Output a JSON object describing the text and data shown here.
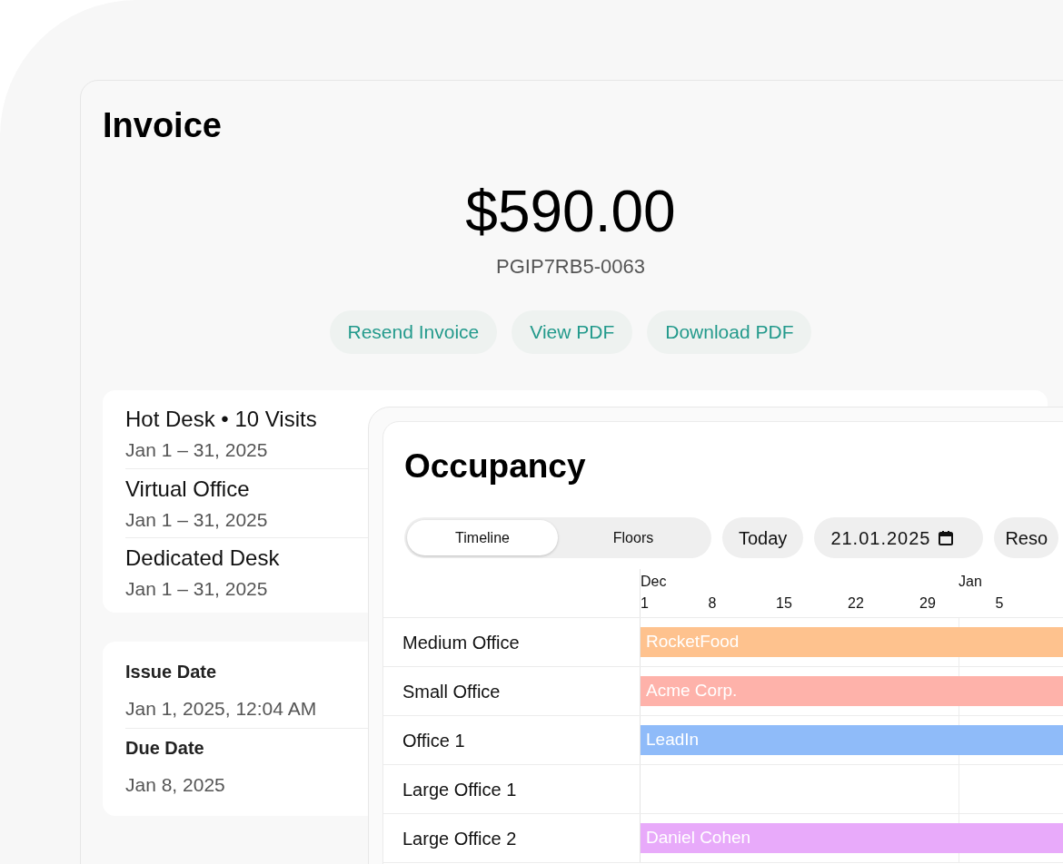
{
  "invoice": {
    "title": "Invoice",
    "amount": "$590.00",
    "number": "PGIP7RB5-0063",
    "actions": [
      "Resend Invoice",
      "View PDF",
      "Download PDF"
    ],
    "line_items": [
      {
        "name": "Hot Desk • 10 Visits",
        "dates": "Jan 1 – 31, 2025"
      },
      {
        "name": "Virtual Office",
        "dates": "Jan 1 – 31, 2025"
      },
      {
        "name": "Dedicated Desk",
        "dates": "Jan 1 – 31, 2025"
      }
    ],
    "dates": [
      {
        "label": "Issue Date",
        "value": "Jan 1, 2025, 12:04 AM"
      },
      {
        "label": "Due Date",
        "value": "Jan 8, 2025"
      }
    ]
  },
  "occupancy": {
    "title": "Occupancy",
    "view_tabs": [
      {
        "label": "Timeline",
        "selected": true
      },
      {
        "label": "Floors",
        "selected": false
      }
    ],
    "today_button": "Today",
    "date_field": {
      "value": "21.01.2025"
    },
    "resources_button": "Reso",
    "months": [
      "Dec",
      "Jan"
    ],
    "ticks": [
      "1",
      "8",
      "15",
      "22",
      "29",
      "5"
    ],
    "rows": [
      {
        "name": "Medium Office",
        "booking": {
          "label": "RocketFood",
          "color": "#fec28e"
        }
      },
      {
        "name": "Small Office",
        "booking": {
          "label": "Acme Corp.",
          "color": "#feb2aa"
        }
      },
      {
        "name": "Office 1",
        "booking": {
          "label": "LeadIn",
          "color": "#8fbbf9"
        }
      },
      {
        "name": "Large Office 1",
        "booking": null
      },
      {
        "name": "Large Office 2",
        "booking": {
          "label": "Daniel Cohen",
          "color": "#e8aafa"
        }
      }
    ]
  }
}
